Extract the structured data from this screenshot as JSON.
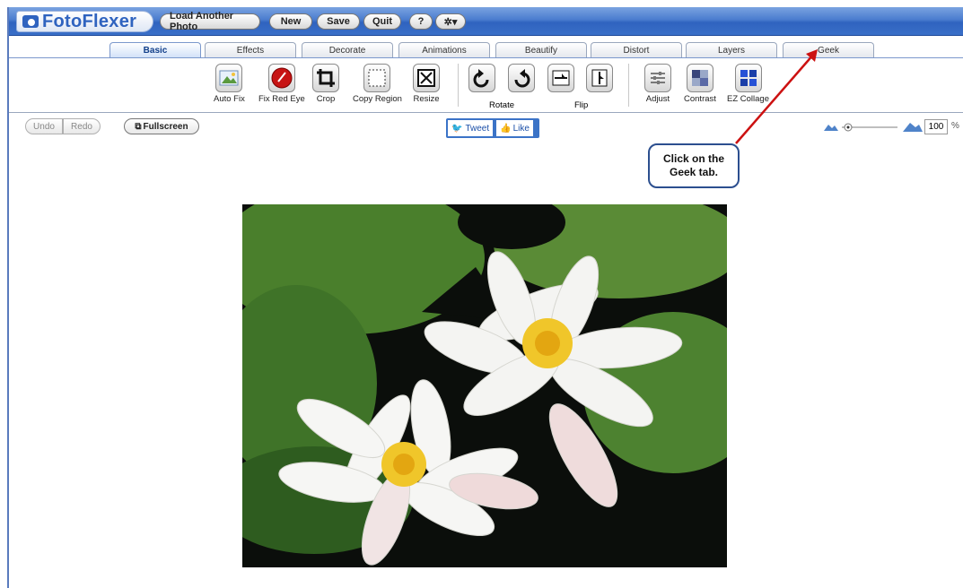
{
  "app": {
    "logo_text": "FotoFlexer",
    "buttons": {
      "load": "Load Another Photo",
      "new": "New",
      "save": "Save",
      "quit": "Quit",
      "help": "?",
      "settings": "✲▾"
    }
  },
  "tabs": [
    {
      "label": "Basic",
      "active": true
    },
    {
      "label": "Effects",
      "active": false
    },
    {
      "label": "Decorate",
      "active": false
    },
    {
      "label": "Animations",
      "active": false
    },
    {
      "label": "Beautify",
      "active": false
    },
    {
      "label": "Distort",
      "active": false
    },
    {
      "label": "Layers",
      "active": false
    },
    {
      "label": "Geek",
      "active": false
    }
  ],
  "tools": {
    "auto_fix": "Auto Fix",
    "fix_red_eye": "Fix Red Eye",
    "crop": "Crop",
    "copy_region": "Copy Region",
    "resize": "Resize",
    "rotate": "Rotate",
    "flip": "Flip",
    "adjust": "Adjust",
    "contrast": "Contrast",
    "ez_collage": "EZ Collage"
  },
  "subbar": {
    "undo": "Undo",
    "redo": "Redo",
    "fullscreen": "Fullscreen",
    "tweet": "Tweet",
    "like": "Like"
  },
  "zoom": {
    "value": "100",
    "unit": "%"
  },
  "callout": {
    "text": "Click on the Geek tab."
  },
  "colors": {
    "header": "#3a6fc8",
    "accent": "#2f63bf",
    "arrow": "#cc1111"
  }
}
